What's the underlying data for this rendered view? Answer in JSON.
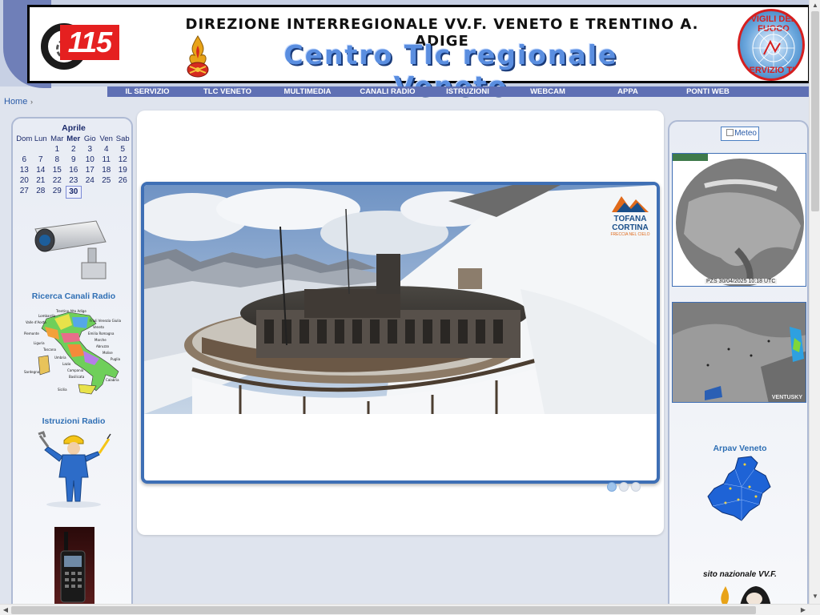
{
  "header": {
    "title_line1": "DIREZIONE INTERREGIONALE VV.F. VENETO E TRENTINO A. ADIGE",
    "title_line2": "Centro Tlc regionale Veneto",
    "logo_number": "115",
    "badge_top": "VIGILI DEL FUOCO",
    "badge_bottom": "SERVIZIO TLC"
  },
  "nav": {
    "items": [
      "IL SERVIZIO",
      "TLC VENETO",
      "MULTIMEDIA",
      "CANALI RADIO",
      "ISTRUZIONI",
      "WEBCAM",
      "APPA",
      "PONTI WEB"
    ]
  },
  "breadcrumb": {
    "home": "Home",
    "separator": "›"
  },
  "calendar": {
    "month": "Aprile",
    "weekdays": [
      "Dom",
      "Lun",
      "Mar",
      "Mer",
      "Gio",
      "Ven",
      "Sab"
    ],
    "weeks": [
      [
        "",
        "",
        "1",
        "2",
        "3",
        "4",
        "5"
      ],
      [
        "6",
        "7",
        "8",
        "9",
        "10",
        "11",
        "12"
      ],
      [
        "13",
        "14",
        "15",
        "16",
        "17",
        "18",
        "19"
      ],
      [
        "20",
        "21",
        "22",
        "23",
        "24",
        "25",
        "26"
      ],
      [
        "27",
        "28",
        "29",
        "30",
        "",
        "",
        ""
      ]
    ],
    "today": "30"
  },
  "left_sidebar": {
    "radio_search_title": "Ricerca Canali Radio",
    "radio_instructions_title": "Istruzioni Radio",
    "map_regions": [
      "Trentino Alto Adige",
      "Lombardia",
      "Friuli Venezia Giulia",
      "Valle d'Aosta",
      "Veneto",
      "Piemonte",
      "Emilia Romagna",
      "Liguria",
      "Marche",
      "Toscana",
      "Abruzzo",
      "Umbria",
      "Molise",
      "Lazio",
      "Puglia",
      "Sardegna",
      "Campania",
      "Basilicata",
      "Calabria",
      "Sicilia"
    ]
  },
  "slider": {
    "webcam_brand": "TOFANA",
    "webcam_brand2": "CORTINA",
    "webcam_tagline": "FRECCIA NEL CIELO",
    "slide_count": 3,
    "active_slide": 0
  },
  "right_sidebar": {
    "meteo_alt": "Meteo",
    "sat_stamp": "PZS 30/04/2025 10:18 UTC",
    "ventusky_label": "VENTUSKY",
    "arpav_title": "Arpav Veneto",
    "vvf_site_title": "sito nazionale VV.F."
  },
  "colors": {
    "nav_bg": "#5f70b4",
    "accent_blue": "#2f6fb4",
    "slider_border": "#3e6fb5",
    "logo_red": "#e52020"
  }
}
